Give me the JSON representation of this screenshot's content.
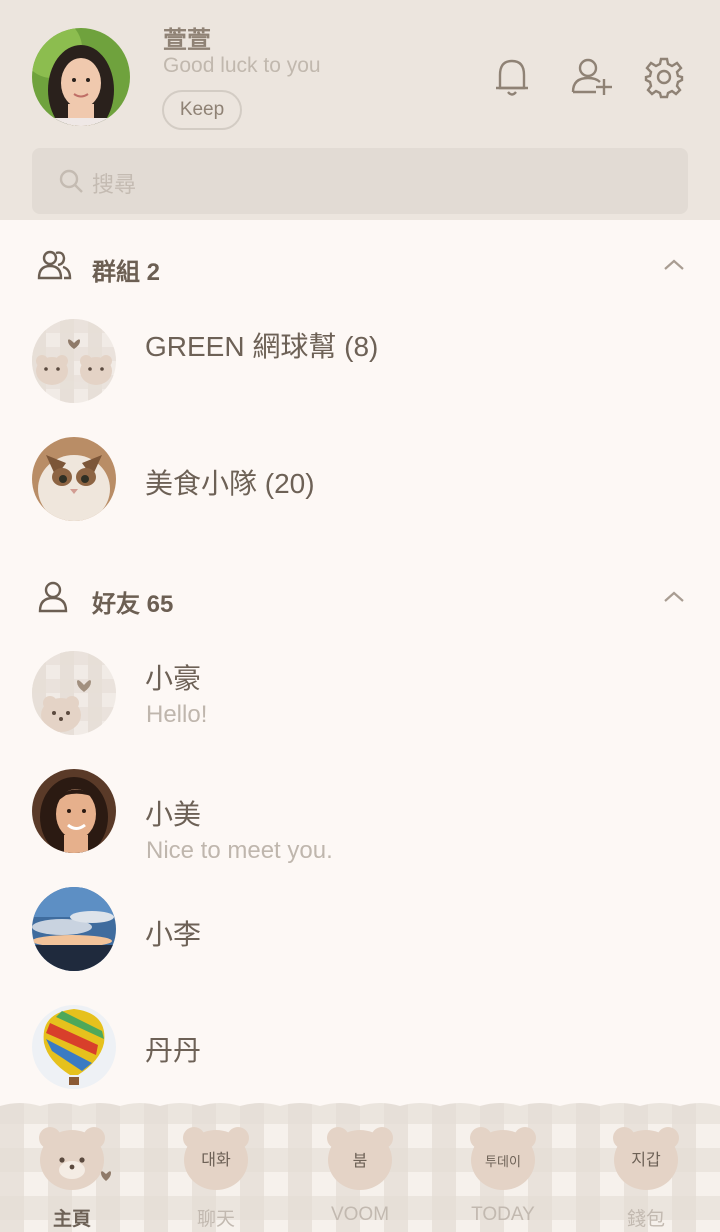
{
  "profile": {
    "name": "萱萱",
    "status": "Good luck to you",
    "keep_label": "Keep"
  },
  "search": {
    "placeholder": "搜尋"
  },
  "groups": {
    "title": "群組 2",
    "items": [
      {
        "name": "GREEN 網球幫 (8)"
      },
      {
        "name": "美食小隊 (20)"
      }
    ]
  },
  "friends": {
    "title": "好友 65",
    "items": [
      {
        "name": "小豪",
        "status": "Hello!"
      },
      {
        "name": "小美",
        "status": "Nice to meet you."
      },
      {
        "name": "小李",
        "status": ""
      },
      {
        "name": "丹丹",
        "status": ""
      }
    ]
  },
  "tabs": [
    {
      "label": "主頁",
      "badge": "",
      "active": true
    },
    {
      "label": "聊天",
      "badge": "대화"
    },
    {
      "label": "VOOM",
      "badge": "붐"
    },
    {
      "label": "TODAY",
      "badge": "투데이"
    },
    {
      "label": "錢包",
      "badge": "지갑"
    }
  ],
  "colors": {
    "header_bg": "#ece5de",
    "content_bg": "#fdf8f5",
    "accent_brown": "#6d6156",
    "bear": "#e4d3c6"
  }
}
